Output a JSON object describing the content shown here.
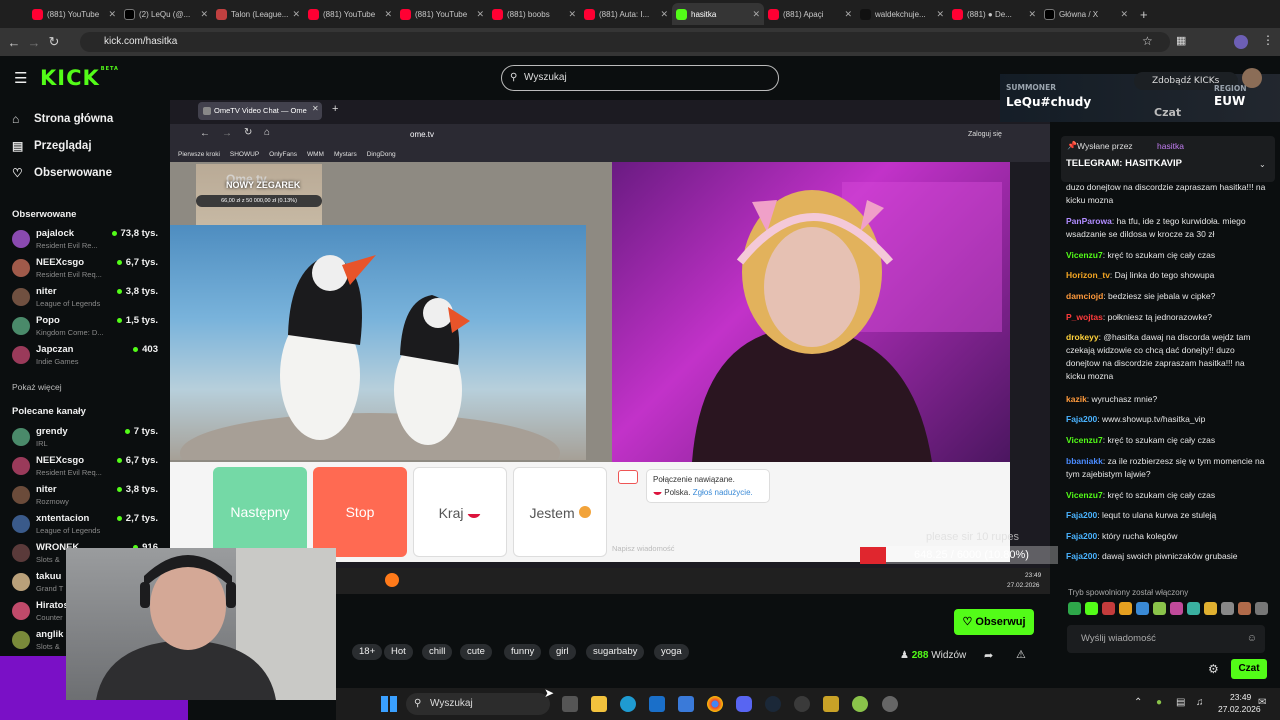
{
  "browser": {
    "tabs": [
      {
        "label": "(881) YouTube",
        "icon": "youtube-icon"
      },
      {
        "label": "(2) LeQu (@...",
        "icon": "x-icon"
      },
      {
        "label": "Talon (League...",
        "icon": "talon-icon"
      },
      {
        "label": "(881) YouTube",
        "icon": "youtube-icon"
      },
      {
        "label": "(881) YouTube",
        "icon": "youtube-icon"
      },
      {
        "label": "(881) boobs",
        "icon": "youtube-icon"
      },
      {
        "label": "(881) Auta: I...",
        "icon": "youtube-icon"
      },
      {
        "label": "hasitka",
        "icon": "kick-icon",
        "active": true
      },
      {
        "label": "(881) Apaçi",
        "icon": "youtube-icon"
      },
      {
        "label": "waldekchuje...",
        "icon": "tiktok-icon"
      },
      {
        "label": "(881) ● De...",
        "icon": "youtube-icon"
      },
      {
        "label": "Główna / X",
        "icon": "x-icon"
      }
    ],
    "url": "kick.com/hasitka"
  },
  "kick": {
    "logo": "KICK",
    "logo_beta": "BETA",
    "search_placeholder": "Wyszukaj",
    "nav": [
      {
        "label": "Strona główna",
        "icon": "home-icon"
      },
      {
        "label": "Przeglądaj",
        "icon": "browse-icon"
      },
      {
        "label": "Obserwowane",
        "icon": "heart-icon"
      }
    ],
    "followed_title": "Obserwowane",
    "followed": [
      {
        "name": "pajalock",
        "game": "Resident Evil Re...",
        "viewers": "73,8 tys."
      },
      {
        "name": "NEEXcsgo",
        "game": "Resident Evil Req...",
        "viewers": "6,7 tys."
      },
      {
        "name": "niter",
        "game": "League of Legends",
        "viewers": "3,8 tys."
      },
      {
        "name": "Popo",
        "game": "Kingdom Come: D...",
        "viewers": "1,5 tys."
      },
      {
        "name": "Japczan",
        "game": "Indie Games",
        "viewers": "403"
      }
    ],
    "show_more": "Pokaż więcej",
    "recommended_title": "Polecane kanały",
    "recommended": [
      {
        "name": "grendy",
        "game": "IRL",
        "viewers": "7 tys."
      },
      {
        "name": "NEEXcsgo",
        "game": "Resident Evil Req...",
        "viewers": "6,7 tys."
      },
      {
        "name": "niter",
        "game": "Rozmowy",
        "viewers": "3,8 tys."
      },
      {
        "name": "xntentacion",
        "game": "League of Legends",
        "viewers": "2,7 tys."
      },
      {
        "name": "WRONEK",
        "game": "Slots &",
        "viewers": "916"
      },
      {
        "name": "takuu",
        "game": "Grand T",
        "viewers": ""
      },
      {
        "name": "Hiratos",
        "game": "Counter",
        "viewers": ""
      },
      {
        "name": "anglik",
        "game": "Slots &",
        "viewers": ""
      }
    ],
    "follow_button": "Obserwuj",
    "tags": [
      "18+",
      "Hot",
      "chill",
      "cute",
      "funny",
      "girl",
      "sugarbaby",
      "yoga"
    ],
    "viewers_count": "288",
    "viewers_label": "Widzów",
    "summoner": {
      "label": "SUMMONER",
      "name": "LeQu#chudy",
      "region_label": "REGION",
      "region": "EUW",
      "promo": "Zdobądź KICKs"
    },
    "chat_tab": "Czat",
    "pinned": {
      "by_label": "Wysłane przez",
      "by_user": "hasitka",
      "text": "TELEGRAM: HASITKAVIP"
    },
    "messages": [
      {
        "user": "",
        "color": "#e6e6e6",
        "text": "duzo donejtow na discordzie zapraszam hasitka!!! na kicku mozna"
      },
      {
        "user": "PanParowa",
        "color": "#b08cff",
        "text": "ha tfu, ide z tego kurwidoła. miego wsadzanie se dildosa w krocze za 30 zł"
      },
      {
        "user": "Vicenzu7",
        "color": "#53fc18",
        "text": "kręć to szukam cię cały czas"
      },
      {
        "user": "Horizon_tv",
        "color": "#f5a623",
        "text": "Daj linka do tego showupa"
      },
      {
        "user": "damciojd",
        "color": "#ff9a3c",
        "text": "bedziesz sie jebala w cipke?"
      },
      {
        "user": "P_wojtas",
        "color": "#ff3b3b",
        "text": "połkniesz tą jednorazowke?"
      },
      {
        "user": "drokeyy",
        "color": "#ffd23c",
        "text": "@hasitka dawaj na discorda wejdz tam czekają widzowie co chcą dać donejty!! duzo donejtow na discordzie zapraszam hasitka!!! na kicku mozna"
      },
      {
        "user": "kazik",
        "color": "#ff9a3c",
        "text": "wyruchasz mnie?"
      },
      {
        "user": "Faja200",
        "color": "#4ab3ff",
        "text": "www.showup.tv/hasitka_vip"
      },
      {
        "user": "Vicenzu7",
        "color": "#53fc18",
        "text": "kręć to szukam cię cały czas"
      },
      {
        "user": "bbaniakk",
        "color": "#4a8bff",
        "text": "za ile rozbierzesz się w tym momencie na tym zajebistym lajwie?"
      },
      {
        "user": "Vicenzu7",
        "color": "#53fc18",
        "text": "kręć to szukam cię cały czas"
      },
      {
        "user": "Faja200",
        "color": "#4ab3ff",
        "text": "lequt to ulana kurwa ze stuleją"
      },
      {
        "user": "Faja200",
        "color": "#4ab3ff",
        "text": "który rucha kolegów"
      },
      {
        "user": "Faja200",
        "color": "#4ab3ff",
        "text": "dawaj swoich piwniczaków grubasie"
      }
    ],
    "slow_mode": "Tryb spowolniony został włączony",
    "chat_placeholder": "Wyślij wiadomość",
    "chat_button": "Czat"
  },
  "stream": {
    "ff_tab": "OmeTV Video Chat — Ome",
    "ff_url": "ome.tv",
    "ff_login": "Zaloguj się",
    "bookmarks": [
      "Pierwsze kroki",
      "SHOWUP",
      "OnlyFans",
      "WMM",
      "Mystars",
      "DingDong"
    ],
    "ome_logo": "Ome tv",
    "overlay_title": "NOWY ZEGAREK",
    "overlay_progress": "66,00 zł z 50 000,00 zł (0.13%)",
    "btn_next": "Następny",
    "btn_stop": "Stop",
    "btn_country": "Kraj",
    "btn_iam": "Jestem",
    "status_line1": "Połączenie nawiązane.",
    "status_line2_country": "Polska.",
    "status_line2_report": "Zgłoś nadużycie.",
    "message_placeholder": "Napisz wiadomość",
    "goal_text": "please sir 10 rupes",
    "goal_progress": "648.25 / 6000 (10.80%)",
    "inner_time": "23:49",
    "inner_date": "27.02.2026"
  },
  "taskbar": {
    "search": "Wyszukaj",
    "time": "23:49",
    "date": "27.02.2026"
  },
  "colors": {
    "kick_green": "#53fc18",
    "stop_red": "#ff6a52",
    "next_green": "#74d9a6"
  }
}
